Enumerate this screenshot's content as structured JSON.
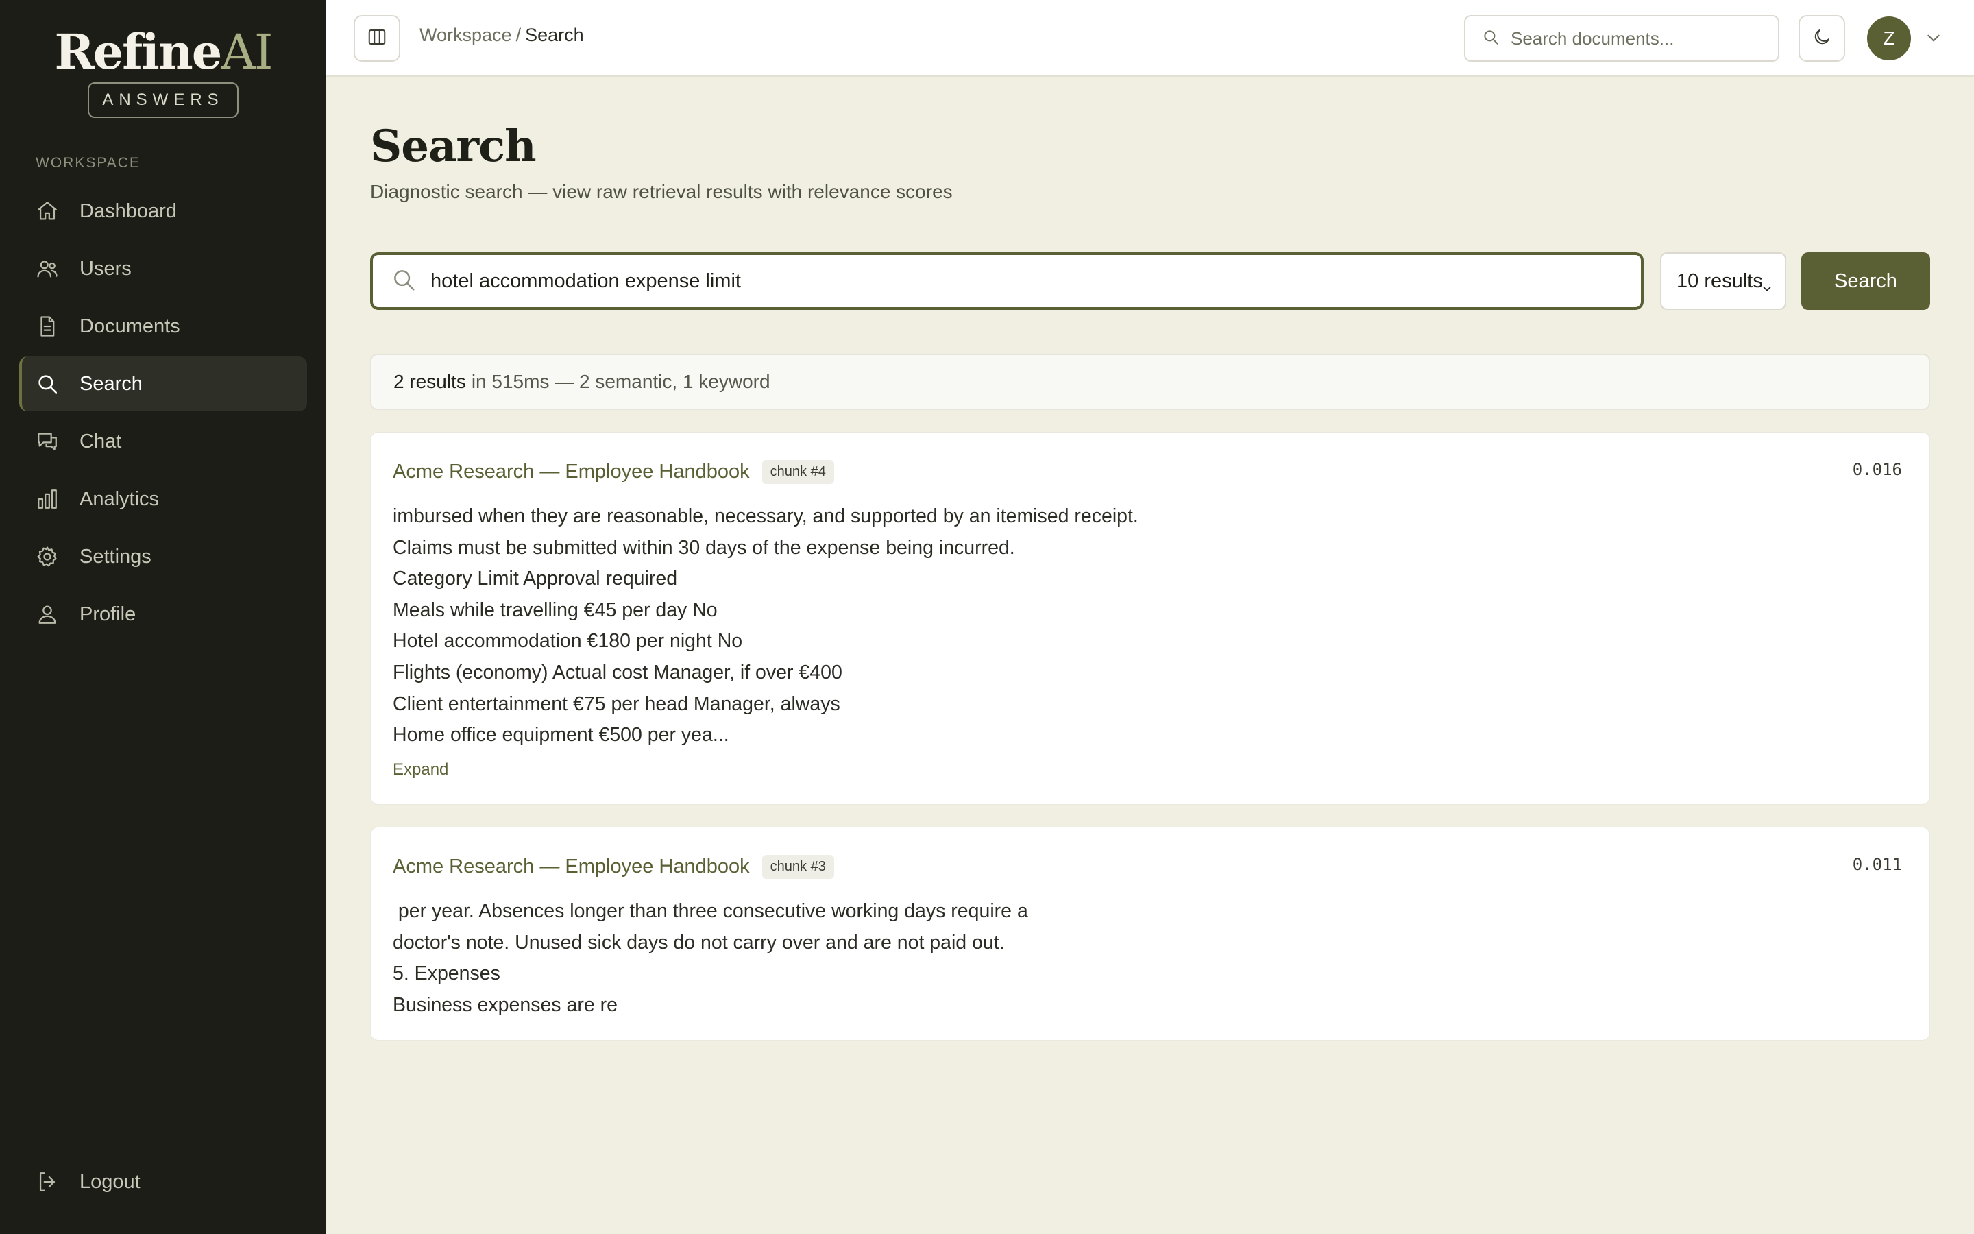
{
  "app": {
    "logo_main": "Refine",
    "logo_accent": "AI",
    "logo_badge": "ANSWERS"
  },
  "sidebar": {
    "section_label": "WORKSPACE",
    "items": [
      {
        "label": "Dashboard",
        "icon": "home-icon"
      },
      {
        "label": "Users",
        "icon": "users-icon"
      },
      {
        "label": "Documents",
        "icon": "document-icon"
      },
      {
        "label": "Search",
        "icon": "search-icon",
        "active": true
      },
      {
        "label": "Chat",
        "icon": "chat-icon"
      },
      {
        "label": "Analytics",
        "icon": "bar-chart-icon"
      },
      {
        "label": "Settings",
        "icon": "gear-icon"
      },
      {
        "label": "Profile",
        "icon": "user-icon"
      }
    ],
    "logout_label": "Logout"
  },
  "topbar": {
    "breadcrumb_root": "Workspace",
    "breadcrumb_sep": "/",
    "breadcrumb_current": "Search",
    "search_placeholder": "Search documents...",
    "avatar_initial": "Z"
  },
  "page": {
    "title": "Search",
    "subtitle": "Diagnostic search — view raw retrieval results with relevance scores"
  },
  "search": {
    "query": "hotel accommodation expense limit",
    "results_limit": "10 results",
    "button_label": "Search"
  },
  "summary": {
    "count": "2 results",
    "detail": "in 515ms — 2 semantic, 1 keyword"
  },
  "results": [
    {
      "title": "Acme Research — Employee Handbook",
      "chunk": "chunk #4",
      "score": "0.016",
      "lines": [
        "imbursed when they are reasonable, necessary, and supported by an itemised receipt.",
        "Claims must be submitted within 30 days of the expense being incurred.",
        "Category Limit Approval required",
        "Meals while travelling €45 per day No",
        "Hotel accommodation €180 per night No",
        "Flights (economy) Actual cost Manager, if over €400",
        "Client entertainment €75 per head Manager, always",
        "Home office equipment €500 per yea..."
      ],
      "expand_label": "Expand"
    },
    {
      "title": "Acme Research — Employee Handbook",
      "chunk": "chunk #3",
      "score": "0.011",
      "lines": [
        " per year. Absences longer than three consecutive working days require a",
        "doctor's note. Unused sick days do not carry over and are not paid out.",
        "5. Expenses",
        "Business expenses are re"
      ]
    }
  ],
  "colors": {
    "sidebar_bg": "#1c1d16",
    "page_bg": "#f1efe2",
    "accent": "#5a6033",
    "logo_accent": "#a8ad84"
  }
}
